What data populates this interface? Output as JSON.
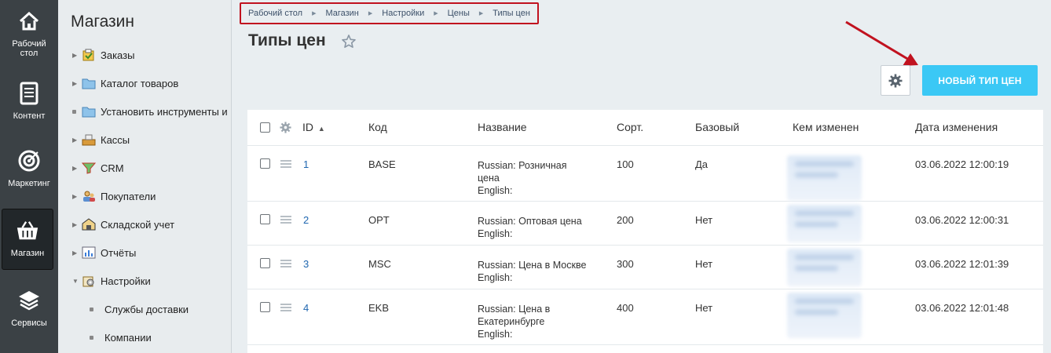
{
  "rail": {
    "items": [
      {
        "label": "Рабочий\nстол",
        "icon": "home-icon"
      },
      {
        "label": "Контент",
        "icon": "document-icon"
      },
      {
        "label": "Маркетинг",
        "icon": "target-icon"
      },
      {
        "label": "Магазин",
        "icon": "basket-icon",
        "active": true
      },
      {
        "label": "Сервисы",
        "icon": "layers-icon"
      }
    ]
  },
  "menu": {
    "title": "Магазин",
    "items": [
      {
        "label": "Заказы",
        "icon": "orders-icon",
        "expander": "arrow"
      },
      {
        "label": "Каталог товаров",
        "icon": "folder-icon",
        "expander": "arrow"
      },
      {
        "label": "Установить инструменты и",
        "icon": "folder-icon",
        "expander": "dot"
      },
      {
        "label": "Кассы",
        "icon": "cashbox-icon",
        "expander": "arrow"
      },
      {
        "label": "CRM",
        "icon": "crm-icon",
        "expander": "arrow"
      },
      {
        "label": "Покупатели",
        "icon": "users-icon",
        "expander": "arrow"
      },
      {
        "label": "Складской учет",
        "icon": "warehouse-icon",
        "expander": "arrow"
      },
      {
        "label": "Отчёты",
        "icon": "reports-icon",
        "expander": "arrow"
      },
      {
        "label": "Настройки",
        "icon": "settings-icon",
        "expander": "arrow-open"
      }
    ],
    "subitems": [
      {
        "label": "Службы доставки"
      },
      {
        "label": "Компании"
      }
    ]
  },
  "breadcrumb": [
    "Рабочий стол",
    "Магазин",
    "Настройки",
    "Цены",
    "Типы цен"
  ],
  "page": {
    "title": "Типы цен",
    "new_button": "НОВЫЙ ТИП ЦЕН"
  },
  "grid": {
    "columns": [
      "ID",
      "Код",
      "Название",
      "Сорт.",
      "Базовый",
      "Кем изменен",
      "Дата изменения"
    ],
    "sort_indicator": "ascending",
    "rows": [
      {
        "id": "1",
        "code": "BASE",
        "name_ru": "Russian: Розничная",
        "name_ru2": "цена",
        "name_en": "English:",
        "sort": "100",
        "base": "Да",
        "date": "03.06.2022 12:00:19"
      },
      {
        "id": "2",
        "code": "OPT",
        "name_ru": "Russian: Оптовая цена",
        "name_ru2": "",
        "name_en": "English:",
        "sort": "200",
        "base": "Нет",
        "date": "03.06.2022 12:00:31"
      },
      {
        "id": "3",
        "code": "MSC",
        "name_ru": "Russian: Цена в Москве",
        "name_ru2": "",
        "name_en": "English:",
        "sort": "300",
        "base": "Нет",
        "date": "03.06.2022 12:01:39"
      },
      {
        "id": "4",
        "code": "EKB",
        "name_ru": "Russian: Цена в",
        "name_ru2": "Екатеринбурге",
        "name_en": "English:",
        "sort": "400",
        "base": "Нет",
        "date": "03.06.2022 12:01:48"
      }
    ]
  },
  "colors": {
    "accent": "#3bc8f5",
    "link": "#2067b0",
    "highlight": "#c1121f",
    "rail": "#3b4145"
  }
}
